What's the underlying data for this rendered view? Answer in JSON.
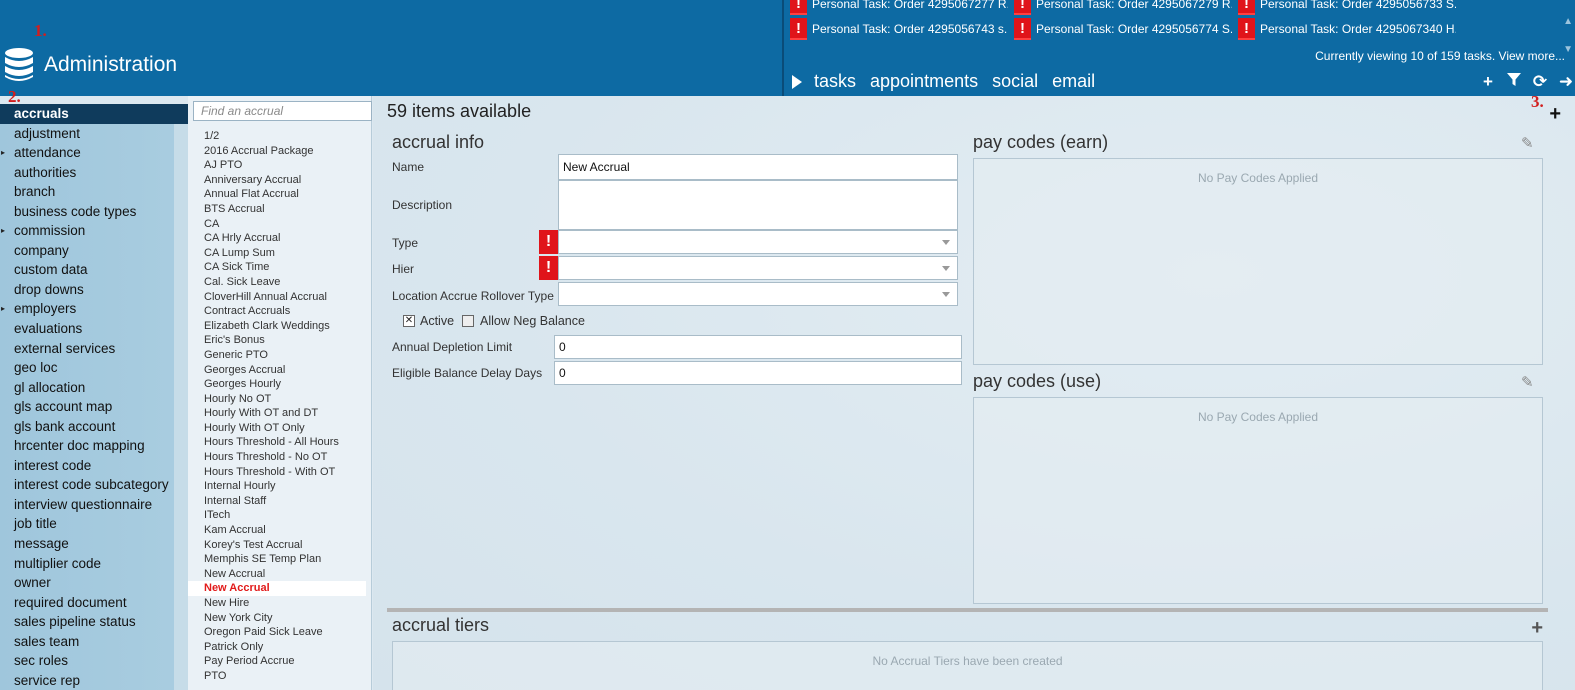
{
  "header": {
    "app_title": "Administration",
    "annotations": [
      "1.",
      "2.",
      "3."
    ]
  },
  "tasks": {
    "items": [
      "Personal Task: Order 4295067277 R...",
      "Personal Task: Order 4295067279 R...",
      "Personal Task: Order 4295056733 S...",
      "Personal Task: Order 4295056743 s...",
      "Personal Task: Order 4295056774 S...",
      "Personal Task: Order 4295067340 H..."
    ],
    "viewing_text": "Currently viewing 10 of 159 tasks. View more...",
    "tabs": [
      "tasks",
      "appointments",
      "social",
      "email"
    ],
    "tools": [
      "plus-icon",
      "filter-icon",
      "refresh-icon",
      "arrow-right-icon"
    ]
  },
  "sidebar": {
    "items": [
      {
        "label": "accruals",
        "active": true,
        "caret": false
      },
      {
        "label": "adjustment",
        "caret": false
      },
      {
        "label": "attendance",
        "caret": true
      },
      {
        "label": "authorities",
        "caret": false
      },
      {
        "label": "branch",
        "caret": false
      },
      {
        "label": "business code types",
        "caret": false
      },
      {
        "label": "commission",
        "caret": true
      },
      {
        "label": "company",
        "caret": false
      },
      {
        "label": "custom data",
        "caret": false
      },
      {
        "label": "drop downs",
        "caret": false
      },
      {
        "label": "employers",
        "caret": true
      },
      {
        "label": "evaluations",
        "caret": false
      },
      {
        "label": "external services",
        "caret": false
      },
      {
        "label": "geo loc",
        "caret": false
      },
      {
        "label": "gl allocation",
        "caret": false
      },
      {
        "label": "gls account map",
        "caret": false
      },
      {
        "label": "gls bank account",
        "caret": false
      },
      {
        "label": "hrcenter doc mapping",
        "caret": false
      },
      {
        "label": "interest code",
        "caret": false
      },
      {
        "label": "interest code subcategory",
        "caret": false
      },
      {
        "label": "interview questionnaire",
        "caret": false
      },
      {
        "label": "job title",
        "caret": false
      },
      {
        "label": "message",
        "caret": false
      },
      {
        "label": "multiplier code",
        "caret": false
      },
      {
        "label": "owner",
        "caret": false
      },
      {
        "label": "required document",
        "caret": false
      },
      {
        "label": "sales pipeline status",
        "caret": false
      },
      {
        "label": "sales team",
        "caret": false
      },
      {
        "label": "sec roles",
        "caret": false
      },
      {
        "label": "service rep",
        "caret": false
      }
    ]
  },
  "accrual_list": {
    "search_placeholder": "Find an accrual",
    "items": [
      "1/2",
      "2016 Accrual Package",
      "AJ PTO",
      "Anniversary Accrual",
      "Annual Flat Accrual",
      "BTS Accrual",
      "CA",
      "CA Hrly Accrual",
      "CA Lump Sum",
      "CA Sick Time",
      "Cal. Sick Leave",
      "CloverHill Annual Accrual",
      "Contract Accruals",
      "Elizabeth Clark Weddings",
      "Eric's Bonus",
      "Generic PTO",
      "Georges Accrual",
      "Georges Hourly",
      "Hourly No OT",
      "Hourly With OT and DT",
      "Hourly With OT Only",
      "Hours Threshold - All Hours",
      "Hours Threshold - No OT",
      "Hours Threshold - With OT",
      "Internal Hourly",
      "Internal Staff",
      "ITech",
      "Kam Accrual",
      "Korey's Test Accrual",
      "Memphis SE Temp Plan",
      "New Accrual",
      "New Accrual",
      "New Hire",
      "New York City",
      "Oregon Paid Sick Leave",
      "Patrick Only",
      "Pay Period Accrue",
      "PTO"
    ],
    "selected_index": 31
  },
  "main": {
    "items_available": "59 items available",
    "accrual_info": {
      "title": "accrual info",
      "name_label": "Name",
      "name_value": "New Accrual",
      "description_label": "Description",
      "description_value": "",
      "type_label": "Type",
      "type_value": "",
      "hier_label": "Hier",
      "hier_value": "",
      "location_label": "Location Accrue Rollover Type",
      "location_value": "",
      "active_label": "Active",
      "active_checked": true,
      "allow_neg_label": "Allow Neg Balance",
      "allow_neg_checked": false,
      "annual_limit_label": "Annual Depletion Limit",
      "annual_limit_value": "0",
      "eligible_delay_label": "Eligible Balance Delay Days",
      "eligible_delay_value": "0",
      "required_mark": "!"
    },
    "pay_codes_earn": {
      "title": "pay codes (earn)",
      "empty": "No Pay Codes Applied"
    },
    "pay_codes_use": {
      "title": "pay codes (use)",
      "empty": "No Pay Codes Applied"
    },
    "accrual_tiers": {
      "title": "accrual tiers",
      "empty": "No Accrual Tiers have been created"
    }
  },
  "colors": {
    "header_bg": "#0d6aa3",
    "sidebar_active": "#0f3b5c",
    "alert_red": "#e0141a",
    "selected_text": "#e21b1b"
  }
}
